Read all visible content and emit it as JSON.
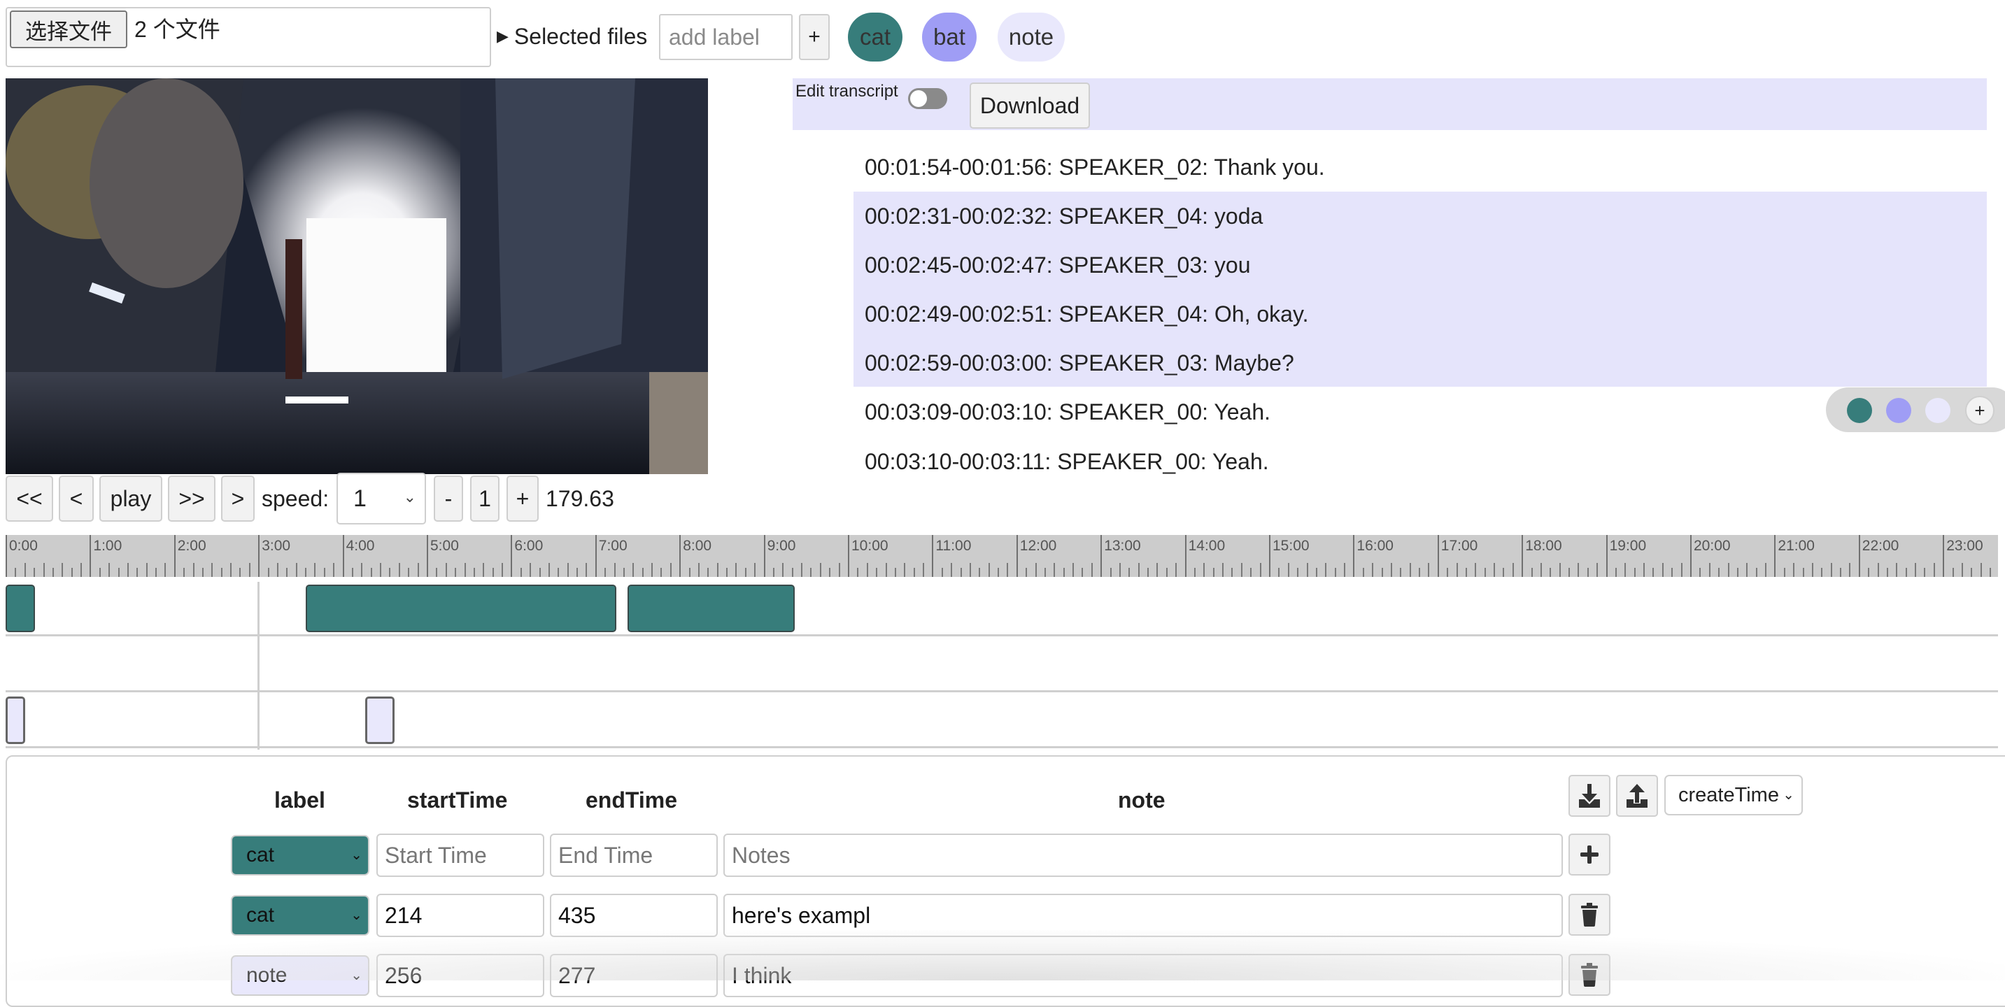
{
  "topbar": {
    "file_button_label": "选择文件",
    "file_count": "2 个文件",
    "selected_files_label": "Selected files",
    "add_label_placeholder": "add label",
    "add_label_button": "+",
    "labels": [
      {
        "name": "cat",
        "color": "#377d7b"
      },
      {
        "name": "bat",
        "color": "#9f9df5"
      },
      {
        "name": "note",
        "color": "#e9e8fc"
      }
    ]
  },
  "video": {
    "description": "video frame: upside-down view inside a van cargo area"
  },
  "controls": {
    "rewind_fast": "<<",
    "rewind": "<",
    "play": "play",
    "forward_fast": ">>",
    "forward": ">",
    "speed_label": "speed:",
    "speed_value": "1",
    "step_minus": "-",
    "step_value": "1",
    "step_plus": "+",
    "current_time": "179.63"
  },
  "transcript": {
    "edit_label": "Edit transcript",
    "edit_enabled": false,
    "download_label": "Download",
    "lines": [
      {
        "text": "00:01:54-00:01:56: SPEAKER_02: Thank you.",
        "highlighted": false
      },
      {
        "text": "00:02:31-00:02:32: SPEAKER_04: yoda",
        "highlighted": true
      },
      {
        "text": "00:02:45-00:02:47: SPEAKER_03: you",
        "highlighted": true
      },
      {
        "text": "00:02:49-00:02:51: SPEAKER_04: Oh, okay.",
        "highlighted": true
      },
      {
        "text": "00:02:59-00:03:00: SPEAKER_03: Maybe?",
        "highlighted": true
      },
      {
        "text": "00:03:09-00:03:10: SPEAKER_00: Yeah.",
        "highlighted": false
      },
      {
        "text": "00:03:10-00:03:11: SPEAKER_00: Yeah.",
        "highlighted": false
      }
    ]
  },
  "palette": {
    "colors": [
      "#377d7b",
      "#9f9df5",
      "#e9e8fc"
    ],
    "add_label": "+"
  },
  "timeline": {
    "tick_labels": [
      "0:00",
      "1:00",
      "2:00",
      "3:00",
      "4:00",
      "5:00",
      "6:00",
      "7:00",
      "8:00",
      "9:00",
      "10:00",
      "11:00",
      "12:00",
      "13:00",
      "14:00",
      "15:00",
      "16:00",
      "17:00",
      "18:00",
      "19:00",
      "20:00",
      "21:00",
      "22:00",
      "23:00"
    ],
    "playhead_seconds": 179.63,
    "tracks": [
      {
        "label": "cat",
        "color": "#377d7b",
        "segments": [
          [
            0,
            21
          ],
          [
            214,
            435
          ],
          [
            443,
            562
          ]
        ]
      },
      {
        "label": "bat",
        "color": "#9f9df5",
        "segments": []
      },
      {
        "label": "note",
        "color": "#e9e8fc",
        "segments": [
          [
            0,
            14
          ],
          [
            256,
            277
          ]
        ]
      }
    ]
  },
  "table": {
    "headers": {
      "label": "label",
      "start": "startTime",
      "end": "endTime",
      "note": "note"
    },
    "sort_value": "createTime",
    "new_row": {
      "label": "cat",
      "start_placeholder": "Start Time",
      "end_placeholder": "End Time",
      "note_placeholder": "Notes",
      "add_button": "+"
    },
    "rows": [
      {
        "label": "cat",
        "start": "214",
        "end": "435",
        "note": "here's exampl"
      },
      {
        "label": "note",
        "start": "256",
        "end": "277",
        "note": "I think"
      }
    ]
  }
}
